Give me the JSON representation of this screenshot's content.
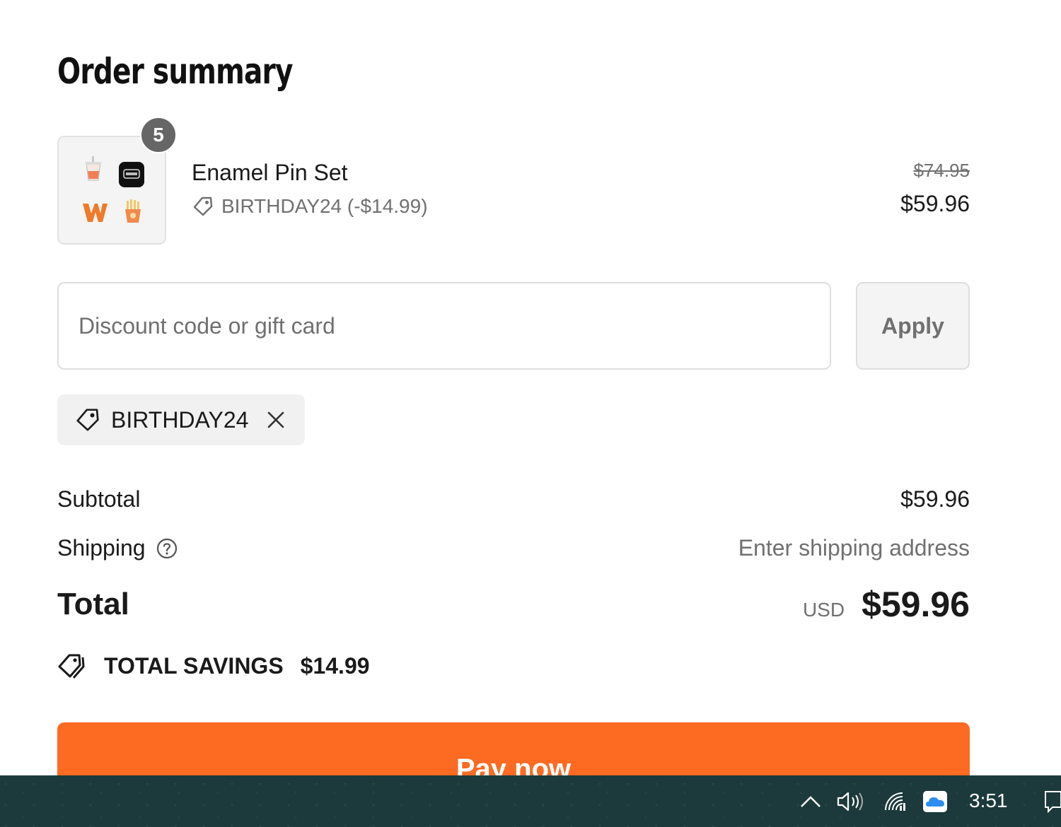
{
  "title": "Order summary",
  "line_item": {
    "name": "Enamel Pin Set",
    "quantity": "5",
    "discount_text": "BIRTHDAY24 (-$14.99)",
    "price_original": "$74.95",
    "price_current": "$59.96",
    "image_icon": "enamel-pin-set-thumbnail"
  },
  "discount": {
    "placeholder": "Discount code or gift card",
    "value": "",
    "apply_label": "Apply",
    "applied_code": "BIRTHDAY24"
  },
  "totals": {
    "subtotal_label": "Subtotal",
    "subtotal_value": "$59.96",
    "shipping_label": "Shipping",
    "shipping_value": "Enter shipping address",
    "total_label": "Total",
    "currency": "USD",
    "total_value": "$59.96",
    "savings_label": "TOTAL SAVINGS",
    "savings_value": "$14.99"
  },
  "pay_button_label": "Pay now",
  "taskbar": {
    "time": "3:51",
    "icons": [
      "chevron-up-icon",
      "volume-icon",
      "wifi-icon",
      "onedrive-cloud-icon",
      "notification-icon"
    ]
  },
  "colors": {
    "accent": "#fd6a22",
    "taskbar": "#1c3a3b",
    "muted_text": "#707070"
  }
}
